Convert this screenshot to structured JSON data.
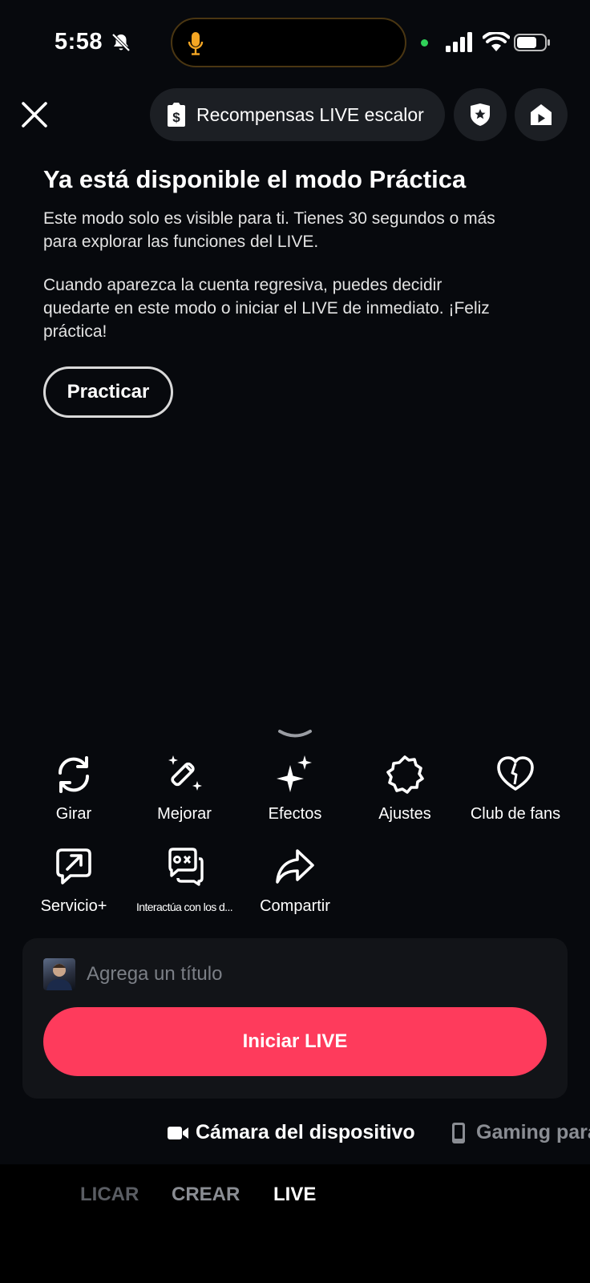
{
  "status_bar": {
    "time": "5:58"
  },
  "top_bar": {
    "rewards_label": "Recompensas LIVE escalor"
  },
  "info": {
    "title": "Ya está disponible el modo Práctica",
    "line1": "Este modo solo es visible para ti. Tienes 30 segundos o más",
    "line2": "para explorar las funciones del LIVE.",
    "line3": "Cuando aparezca la cuenta regresiva, puedes decidir",
    "line4": "quedarte en este modo o iniciar el LIVE de inmediato. ¡Feliz",
    "line5": "práctica!",
    "practice_button": "Practicar"
  },
  "tools": {
    "row1": [
      "Girar",
      "Mejorar",
      "Efectos",
      "Ajustes",
      "Club de fans"
    ],
    "row2": [
      "Servicio+",
      "Interactúa con los d...",
      "Compartir"
    ]
  },
  "panel": {
    "title_placeholder": "Agrega un título",
    "start_button": "Iniciar LIVE"
  },
  "sources": {
    "active": "Cámara del dispositivo",
    "next": "Gaming para"
  },
  "modes": {
    "items": [
      "LICAR",
      "CREAR",
      "LIVE"
    ],
    "selected": "LIVE"
  },
  "colors": {
    "accent": "#fe3b5c",
    "background": "#07090d",
    "panel": "#121418"
  }
}
